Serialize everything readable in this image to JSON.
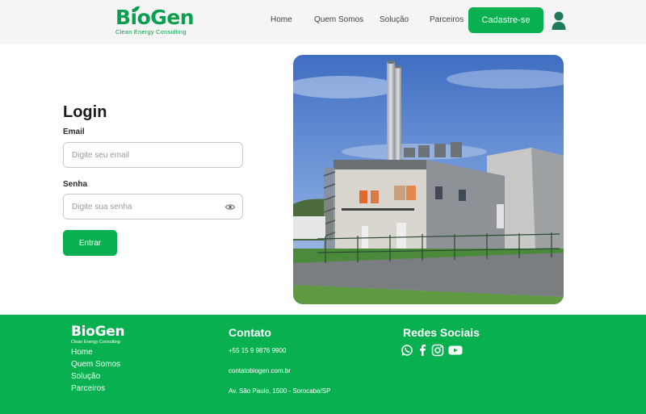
{
  "brand": {
    "name": "BioGen",
    "tagline": "Clean Energy Consulting",
    "color": "#0a9f4c"
  },
  "nav": {
    "items": [
      "Home",
      "Quem Somos",
      "Solução",
      "Parceiros"
    ],
    "cta_label": "Cadastre-se",
    "user_icon": "user-icon"
  },
  "login": {
    "title": "Login",
    "email_label": "Email",
    "email_placeholder": "Digite seu email",
    "password_label": "Senha",
    "password_placeholder": "Digite sua senha",
    "password_toggle_icon": "eye-icon",
    "submit_label": "Entrar"
  },
  "hero_image": {
    "subject": "industrial biogas plant building with tall chimneys"
  },
  "footer": {
    "links": [
      "Home",
      "Quem Somos",
      "Solução",
      "Parceiros"
    ],
    "contact_heading": "Contato",
    "phone": "+55 15 9 9876 9900",
    "email": "contatobiogen.com.br",
    "address": "Av. São Paulo, 1500 - Sorocaba/SP",
    "social_heading": "Redes Sociais",
    "social_icons": [
      "whatsapp-icon",
      "facebook-icon",
      "instagram-icon",
      "youtube-icon"
    ]
  },
  "colors": {
    "accent": "#08b04f",
    "header_bg": "#f5f5f5",
    "footer_bg": "#08b04f"
  }
}
